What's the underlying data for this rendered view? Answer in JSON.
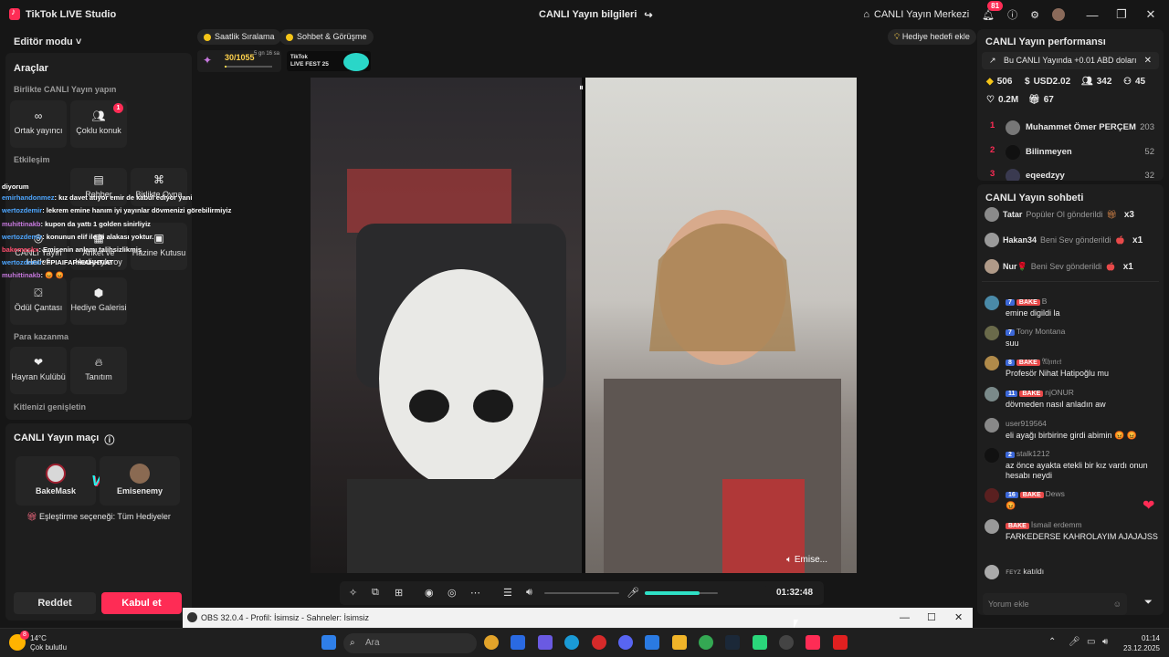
{
  "titlebar": {
    "app_name": "TikTok LIVE Studio",
    "center_title": "CANLI Yayın bilgileri",
    "live_center": "CANLI Yayın Merkezi",
    "notif_count": "81"
  },
  "left": {
    "editor_mode": "Editör modu",
    "tools_title": "Araçlar",
    "collab_title": "Birlikte CANLI Yayın yapın",
    "tools": [
      {
        "label": "Ortak yayıncı",
        "icon": "link-icon"
      },
      {
        "label": "Çoklu konuk",
        "icon": "users-icon",
        "badge": "1"
      },
      {
        "label": "Rehber",
        "icon": "book-icon"
      },
      {
        "label": "Birlikte Oyna",
        "icon": "gamepad-icon"
      },
      {
        "label": "CANLI Yayın Hedefi",
        "icon": "target-icon"
      },
      {
        "label": "Anket ve Hediyeyle oy",
        "icon": "poll-icon"
      },
      {
        "label": "Hazine Kutusu",
        "icon": "chest-icon"
      },
      {
        "label": "Ödül Çantası",
        "icon": "bag-icon"
      },
      {
        "label": "Hediye Galerisi",
        "icon": "gift-gallery-icon"
      }
    ],
    "interaction_title": "Etkileşim",
    "money_title": "Para kazanma",
    "money_tools": [
      {
        "label": "Hayran Kulübü",
        "icon": "heart-icon"
      },
      {
        "label": "Tanıtım",
        "icon": "flame-icon"
      }
    ],
    "audience_title": "Kitlenizi genişletin",
    "match_title": "CANLI Yayın maçı",
    "fighter_left": "BakeMask",
    "fighter_right": "Emisenemy",
    "vs": "VS",
    "pairing": "Eşleştirme seçeneği: Tüm Hediyeler",
    "reject": "Reddet",
    "accept": "Kabul et"
  },
  "overlay_chat": [
    {
      "user": "",
      "text": "diyorum"
    },
    {
      "user": "emirhandonmez",
      "text": ": kız davet atıyor emir de kabul ediyor yani"
    },
    {
      "user": "wertozdemir",
      "text": ": lekrem emine hanım iyi yayınlar dövmenizi görebilirmiyiz"
    },
    {
      "user": "muhittinakb",
      "text": ": kupon da yattı 1 golden sinirliyiz"
    },
    {
      "user": "wertozdemir",
      "text": ": konunun elif ile bi alakası yoktur."
    },
    {
      "user": "bakemaskx",
      "text": ": Emişenin anlamı talihsizlikmiş"
    },
    {
      "user": "wertozdemir",
      "text": ": FPIAIFAPHIAHHTIAT"
    },
    {
      "user": "muhittinakb",
      "text": ": 😡 😡"
    }
  ],
  "center": {
    "pill_ranking": "Saatlik Sıralama",
    "pill_chat": "Sohbet & Görüşme",
    "goal_progress": "30/1055",
    "goal_time": "5 gn 16 sa",
    "goal_fraction": 0.03,
    "fest_line1": "TikTok",
    "fest_line2": "LIVE FEST 25",
    "gift_goal": "Hediye hedefi ekle",
    "guest_name": "Emise...",
    "timer": "01:32:48",
    "mic_level": 0.75
  },
  "right": {
    "perf_title": "CANLI Yayın performansı",
    "banner": "Bu CANLI Yayında +0.01 ABD doları",
    "stats": {
      "diamonds": "506",
      "usd": "USD2.02",
      "viewers": "342",
      "shares": "45",
      "likes": "0.2M",
      "gifters": "67"
    },
    "ranking": [
      {
        "rank": "1",
        "name": "Muhammet Ömer PERÇEM",
        "score": "203"
      },
      {
        "rank": "2",
        "name": "Bilinmeyen",
        "score": "52"
      },
      {
        "rank": "3",
        "name": "eqeedzyy",
        "score": "32"
      }
    ],
    "chat_title": "CANLI Yayın sohbeti",
    "gifts": [
      {
        "name": "Tatar",
        "action": "Popüler Ol gönderildi",
        "count": "x3"
      },
      {
        "name": "Hakan34",
        "action": "Beni Sev gönderildi",
        "count": "x1"
      },
      {
        "name": "Nur🌹",
        "action": "Beni Sev gönderildi",
        "count": "x1"
      }
    ],
    "messages": [
      {
        "level": "7",
        "fan": "BAKE",
        "user": "B",
        "text": "emine digildi la"
      },
      {
        "level": "7",
        "fan": "",
        "user": "Tony Montana",
        "text": "suu"
      },
      {
        "level": "8",
        "fan": "BAKE",
        "user": "𝔄𝔥𝔪𝔢𝔱",
        "text": "Profesör Nihat Hatipoğlu mu"
      },
      {
        "level": "11",
        "fan": "BAKE",
        "user": "njONUR",
        "text": "dövmeden nasıl anladın aw"
      },
      {
        "level": "",
        "fan": "",
        "user": "user919564",
        "text": "eli ayağı birbirine girdi abimin 😡 😡"
      },
      {
        "level": "2",
        "fan": "",
        "user": "stalk1212",
        "text": "az önce ayakta etekli bir kız vardı onun hesabı neydi"
      },
      {
        "level": "16",
        "fan": "BAKE",
        "user": "Dews",
        "text": "😡"
      },
      {
        "level": "",
        "fan": "BAKE",
        "user": "İsmail erdemm",
        "text": "FARKEDERSE KAHROLAYIM AJAJAJSS"
      }
    ],
    "joined_user": "ꜰᴇʏᴢ",
    "joined_text": "katıldı",
    "comment_placeholder": "Yorum ekle"
  },
  "obs": {
    "title": "OBS 32.0.4 - Profil: İsimsiz - Sahneler: İsimsiz"
  },
  "taskbar": {
    "temp": "14°C",
    "weather": "Çok bulutlu",
    "weather_badge": "8",
    "search": "Ara",
    "time": "01:14",
    "date": "23.12.2025"
  }
}
